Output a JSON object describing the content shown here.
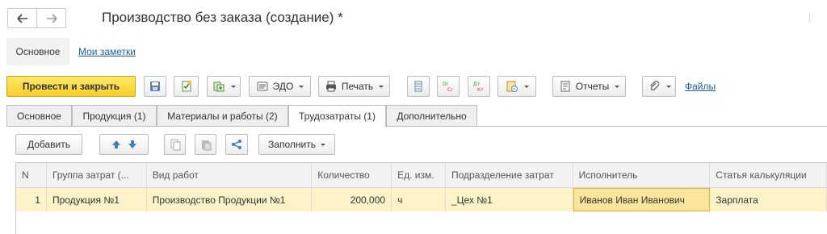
{
  "window": {
    "title": "Производство без заказа (создание) *"
  },
  "form_nav": {
    "main": "Основное",
    "notes": "Мои заметки"
  },
  "commands": {
    "post_close": "Провести и закрыть",
    "edo": "ЭДО",
    "print": "Печать",
    "reports": "Отчеты",
    "files": "Файлы",
    "dt_kt_1": "Dr Cr",
    "dt_kt_2": "Дт Кт"
  },
  "tabs": [
    {
      "label": "Основное"
    },
    {
      "label": "Продукция (1)"
    },
    {
      "label": "Материалы и работы (2)"
    },
    {
      "label": "Трудозатраты (1)"
    },
    {
      "label": "Дополнительно"
    }
  ],
  "active_tab": "Трудозатраты (1)",
  "table_commands": {
    "add": "Добавить",
    "fill": "Заполнить"
  },
  "table": {
    "columns": [
      "N",
      "Группа затрат (...",
      "Вид работ",
      "Количество",
      "Ед. изм.",
      "Подразделение затрат",
      "Исполнитель",
      "Статья калькуляции"
    ],
    "rows": [
      [
        "1",
        "Продукция №1",
        "Производство Продукции №1",
        "200,000",
        "ч",
        "_Цех №1",
        "Иванов Иван Иванович",
        "Зарплата"
      ]
    ]
  },
  "colors": {
    "primary_button": "#f5cf27",
    "row_highlight": "#fcf3c8",
    "link": "#1a5fa8"
  }
}
